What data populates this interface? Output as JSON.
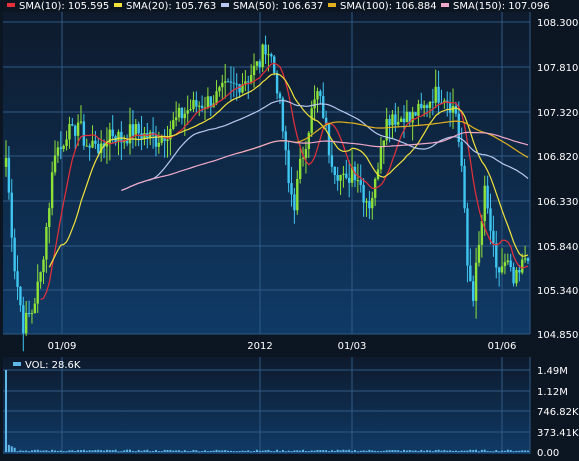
{
  "colors": {
    "background": "#0c1522",
    "panel_top": "#0e1a2c",
    "panel_bottom": "#0f3a66",
    "grid": "#2f5a86",
    "text": "#ffffff",
    "up": "#8de23a",
    "down": "#3ec6f0",
    "sma10": "#e8303a",
    "sma20": "#f2e23a",
    "sma50": "#b8c8f0",
    "sma100": "#e0b020",
    "sma150": "#f0a8c8",
    "volume": "#5fb8e8"
  },
  "legend": [
    {
      "label": "SMA(10): 105.595",
      "color": "#e8303a"
    },
    {
      "label": "SMA(20): 105.763",
      "color": "#f2e23a"
    },
    {
      "label": "SMA(50): 106.637",
      "color": "#b8c8f0"
    },
    {
      "label": "SMA(100): 106.884",
      "color": "#e0b020"
    },
    {
      "label": "SMA(150): 107.096",
      "color": "#f0a8c8"
    }
  ],
  "volume_legend": {
    "label": "VOL: 28.6K",
    "color": "#5fb8e8"
  },
  "chart_data": [
    {
      "type": "candlestick",
      "x_ticks": [
        "01/09",
        "2012",
        "01/03",
        "01/06"
      ],
      "y_ticks": [
        "108.300",
        "107.810",
        "107.320",
        "106.820",
        "106.330",
        "105.840",
        "105.340",
        "104.850"
      ],
      "ylim": [
        104.85,
        108.3
      ],
      "grid": true,
      "anchors": [
        [
          0,
          106.8
        ],
        [
          3,
          105.6
        ],
        [
          6,
          104.95
        ],
        [
          9,
          105.1
        ],
        [
          12,
          105.5
        ],
        [
          15,
          106.3
        ],
        [
          17,
          106.9
        ],
        [
          19,
          106.9
        ],
        [
          21,
          107.1
        ],
        [
          23,
          107.05
        ],
        [
          25,
          107.2
        ],
        [
          27,
          107.0
        ],
        [
          29,
          106.9
        ],
        [
          31,
          107.0
        ],
        [
          33,
          106.85
        ],
        [
          36,
          107.1
        ],
        [
          40,
          107.0
        ],
        [
          44,
          107.1
        ],
        [
          48,
          107.05
        ],
        [
          52,
          107.0
        ],
        [
          56,
          107.1
        ],
        [
          60,
          107.25
        ],
        [
          64,
          107.35
        ],
        [
          68,
          107.4
        ],
        [
          72,
          107.45
        ],
        [
          76,
          107.55
        ],
        [
          80,
          107.6
        ],
        [
          84,
          107.7
        ],
        [
          88,
          107.85
        ],
        [
          90,
          108.05
        ],
        [
          92,
          107.9
        ],
        [
          94,
          107.6
        ],
        [
          96,
          107.1
        ],
        [
          98,
          106.5
        ],
        [
          100,
          106.3
        ],
        [
          102,
          106.7
        ],
        [
          104,
          107.0
        ],
        [
          106,
          107.3
        ],
        [
          108,
          107.5
        ],
        [
          110,
          107.3
        ],
        [
          112,
          106.9
        ],
        [
          114,
          106.7
        ],
        [
          116,
          106.6
        ],
        [
          118,
          106.5
        ],
        [
          120,
          106.7
        ],
        [
          122,
          106.6
        ],
        [
          124,
          106.4
        ],
        [
          126,
          106.3
        ],
        [
          128,
          106.5
        ],
        [
          130,
          107.0
        ],
        [
          132,
          107.2
        ],
        [
          134,
          107.3
        ],
        [
          136,
          107.2
        ],
        [
          138,
          107.3
        ],
        [
          140,
          107.2
        ],
        [
          142,
          107.3
        ],
        [
          144,
          107.3
        ],
        [
          146,
          107.4
        ],
        [
          148,
          107.5
        ],
        [
          150,
          107.5
        ],
        [
          152,
          107.5
        ],
        [
          154,
          107.4
        ],
        [
          156,
          107.3
        ],
        [
          158,
          106.7
        ],
        [
          160,
          105.6
        ],
        [
          162,
          105.3
        ],
        [
          164,
          105.8
        ],
        [
          166,
          106.4
        ],
        [
          168,
          106.0
        ],
        [
          170,
          105.5
        ],
        [
          172,
          105.6
        ],
        [
          174,
          105.6
        ],
        [
          176,
          105.4
        ],
        [
          178,
          105.5
        ],
        [
          180,
          105.7
        ],
        [
          181,
          105.75
        ]
      ],
      "candle_count": 182,
      "series": [
        {
          "name": "SMA(10)",
          "period": 10,
          "value": 105.595
        },
        {
          "name": "SMA(20)",
          "period": 20,
          "value": 105.763
        },
        {
          "name": "SMA(50)",
          "period": 50,
          "value": 106.637
        },
        {
          "name": "SMA(100)",
          "period": 100,
          "value": 106.884
        },
        {
          "name": "SMA(150)",
          "period": 150,
          "value": 107.096
        }
      ]
    },
    {
      "type": "bar",
      "title": "VOL: 28.6K",
      "y_ticks": [
        "1.49M",
        "1.12M",
        "746.82K",
        "373.41K",
        "0.00"
      ],
      "ylim": [
        0,
        1490000
      ],
      "first_bar_value": 1490000,
      "typical_value": 28600
    }
  ]
}
